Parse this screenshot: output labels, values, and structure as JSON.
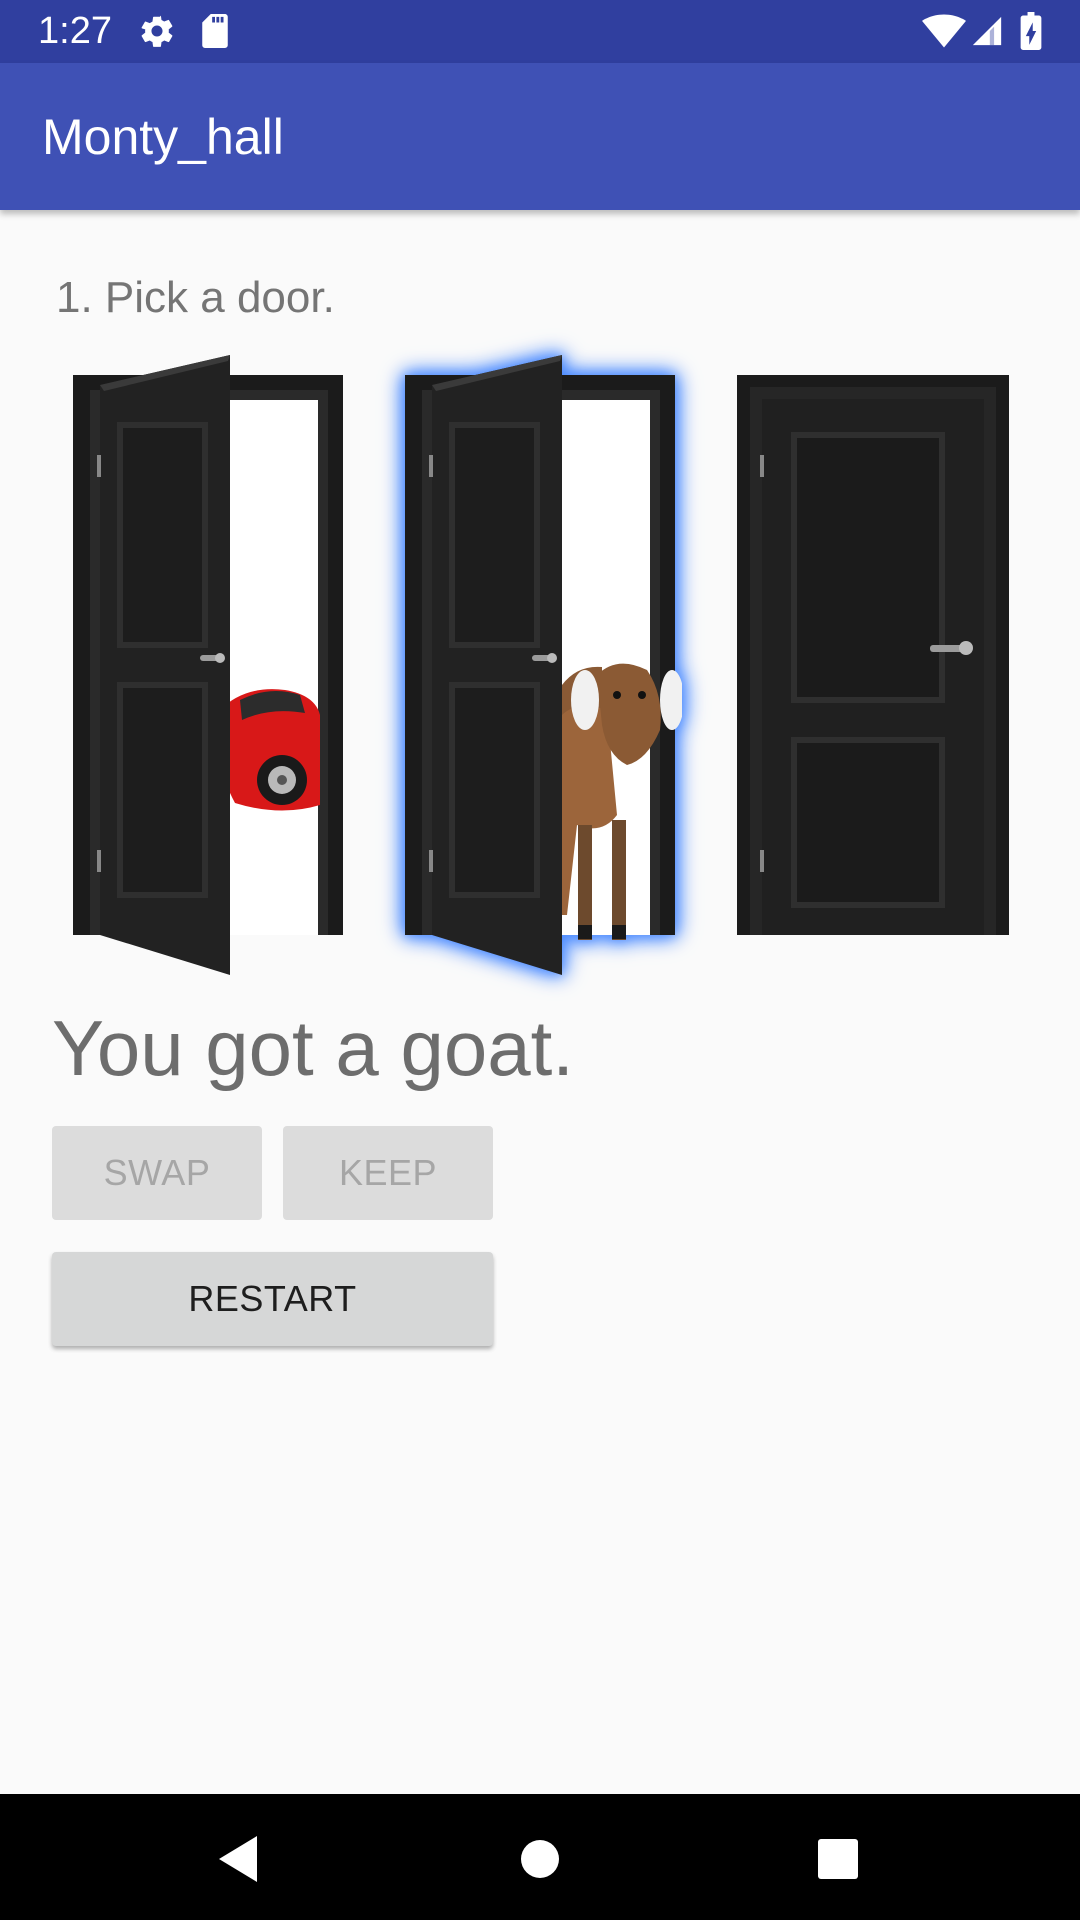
{
  "status_bar": {
    "time": "1:27",
    "icons": [
      "settings-icon",
      "sd-card-icon",
      "wifi-icon",
      "cell-signal-icon",
      "battery-charging-icon"
    ]
  },
  "app_bar": {
    "title": "Monty_hall"
  },
  "main": {
    "instruction": "1. Pick a door.",
    "doors": [
      {
        "state": "open",
        "content": "car"
      },
      {
        "state": "open",
        "content": "goat",
        "selected": true
      },
      {
        "state": "closed",
        "content": ""
      }
    ],
    "result": "You got a goat.",
    "buttons": {
      "swap": "SWAP",
      "keep": "KEEP",
      "restart": "RESTART"
    }
  },
  "colors": {
    "status_bar": "#303f9f",
    "app_bar": "#3f51b5",
    "highlight": "#4d8cff"
  },
  "nav_bar": {
    "icons": [
      "back-icon",
      "home-icon",
      "recents-icon"
    ]
  }
}
